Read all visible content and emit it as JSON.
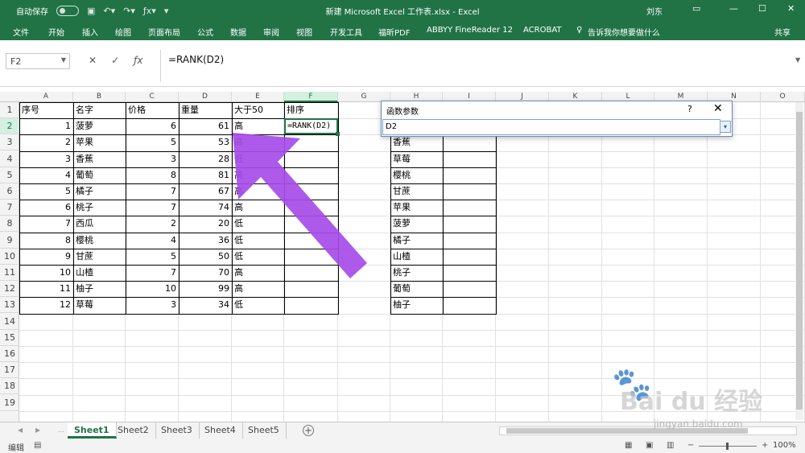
{
  "titlebar": {
    "autosave": "自动保存",
    "title": "新建 Microsoft Excel 工作表.xlsx  -  Excel",
    "user": "刘东",
    "qat_icons": [
      "toggle-icon",
      "save-icon",
      "undo-icon",
      "redo-icon",
      "function-icon",
      "customize-icon"
    ]
  },
  "ribbon": {
    "tabs": [
      "文件",
      "开始",
      "插入",
      "绘图",
      "页面布局",
      "公式",
      "数据",
      "审阅",
      "视图",
      "开发工具",
      "福昕PDF",
      "ABBYY FineReader 12",
      "ACROBAT"
    ],
    "tellme": "告诉我你想要做什么",
    "share": "共享"
  },
  "formula_bar": {
    "name_box": "F2",
    "formula": "=RANK(D2)"
  },
  "columns": [
    "A",
    "B",
    "C",
    "D",
    "E",
    "F",
    "G",
    "H",
    "I",
    "J",
    "K",
    "L",
    "M",
    "N",
    "O"
  ],
  "rows": [
    "1",
    "2",
    "3",
    "4",
    "5",
    "6",
    "7",
    "8",
    "9",
    "10",
    "11",
    "12",
    "13",
    "14",
    "15",
    "16",
    "17",
    "18",
    "19"
  ],
  "table": {
    "headers": [
      "序号",
      "名字",
      "价格",
      "重量",
      "大于50",
      "排序"
    ],
    "rows": [
      [
        "1",
        "菠萝",
        "6",
        "61",
        "高"
      ],
      [
        "2",
        "苹果",
        "5",
        "53",
        "高"
      ],
      [
        "3",
        "香蕉",
        "3",
        "28",
        "低"
      ],
      [
        "4",
        "葡萄",
        "8",
        "81",
        "高"
      ],
      [
        "5",
        "橘子",
        "7",
        "67",
        "高"
      ],
      [
        "6",
        "桃子",
        "7",
        "74",
        "高"
      ],
      [
        "7",
        "西瓜",
        "2",
        "20",
        "低"
      ],
      [
        "8",
        "樱桃",
        "4",
        "36",
        "低"
      ],
      [
        "9",
        "甘蔗",
        "5",
        "50",
        "低"
      ],
      [
        "10",
        "山楂",
        "7",
        "70",
        "高"
      ],
      [
        "11",
        "柚子",
        "10",
        "99",
        "高"
      ],
      [
        "12",
        "草莓",
        "3",
        "34",
        "低"
      ]
    ]
  },
  "active_cell": "=RANK(D2)",
  "side_list": [
    "香蕉",
    "草莓",
    "樱桃",
    "甘蔗",
    "苹果",
    "菠萝",
    "橘子",
    "山楂",
    "桃子",
    "葡萄",
    "柚子"
  ],
  "dialog": {
    "title": "函数参数",
    "help": "?",
    "close": "✕",
    "input": "D2"
  },
  "sheets": [
    "Sheet1",
    "Sheet2",
    "Sheet3",
    "Sheet4",
    "Sheet5"
  ],
  "status": {
    "mode": "编辑",
    "zoom": "100%"
  },
  "watermark": {
    "brand": "Bai du 经验",
    "url": "jingyan.baidu.com"
  }
}
